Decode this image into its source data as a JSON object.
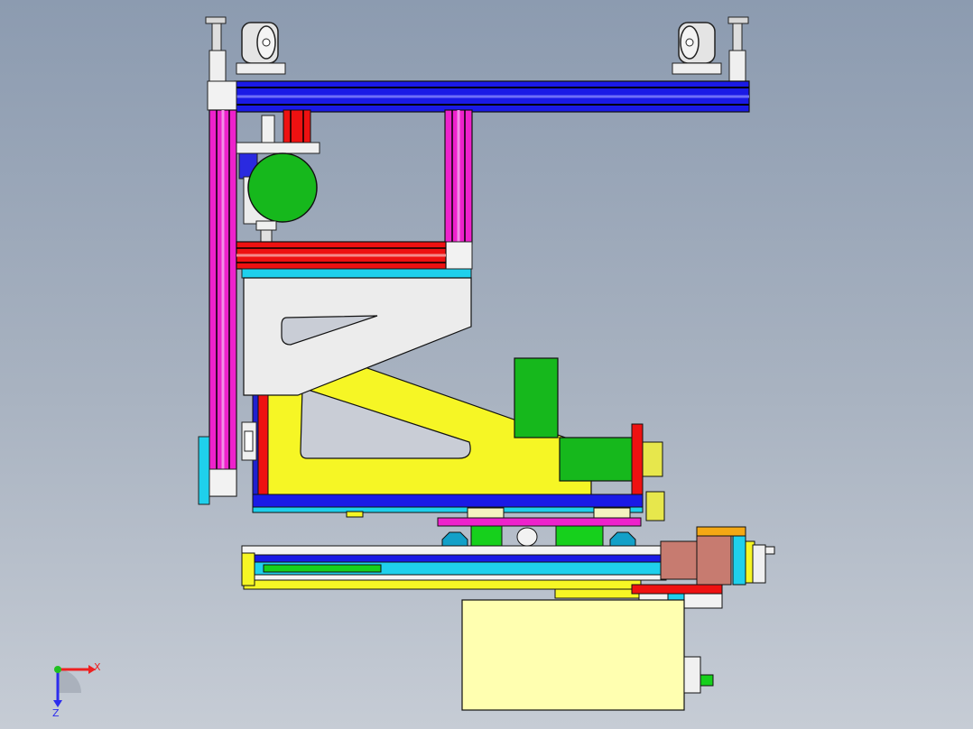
{
  "viewport": {
    "background_top": "#8c9bb0",
    "background_bottom": "#c6ccd5"
  },
  "colors": {
    "frame_blue": "#1a1ae6",
    "frame_magenta": "#ee22cc",
    "frame_red": "#ee1111",
    "plate_yellow": "#f6f625",
    "motor_green": "#16b81c",
    "light_gray": "#ececec",
    "cyan": "#1fd0ec",
    "pale_yellow": "#ffffb0",
    "motor_brown": "#c77b70"
  },
  "triad": {
    "x_label": "X",
    "z_label": "Z",
    "x_color": "#ee2020",
    "z_color": "#2c2cee",
    "y_color": "#20c020"
  }
}
